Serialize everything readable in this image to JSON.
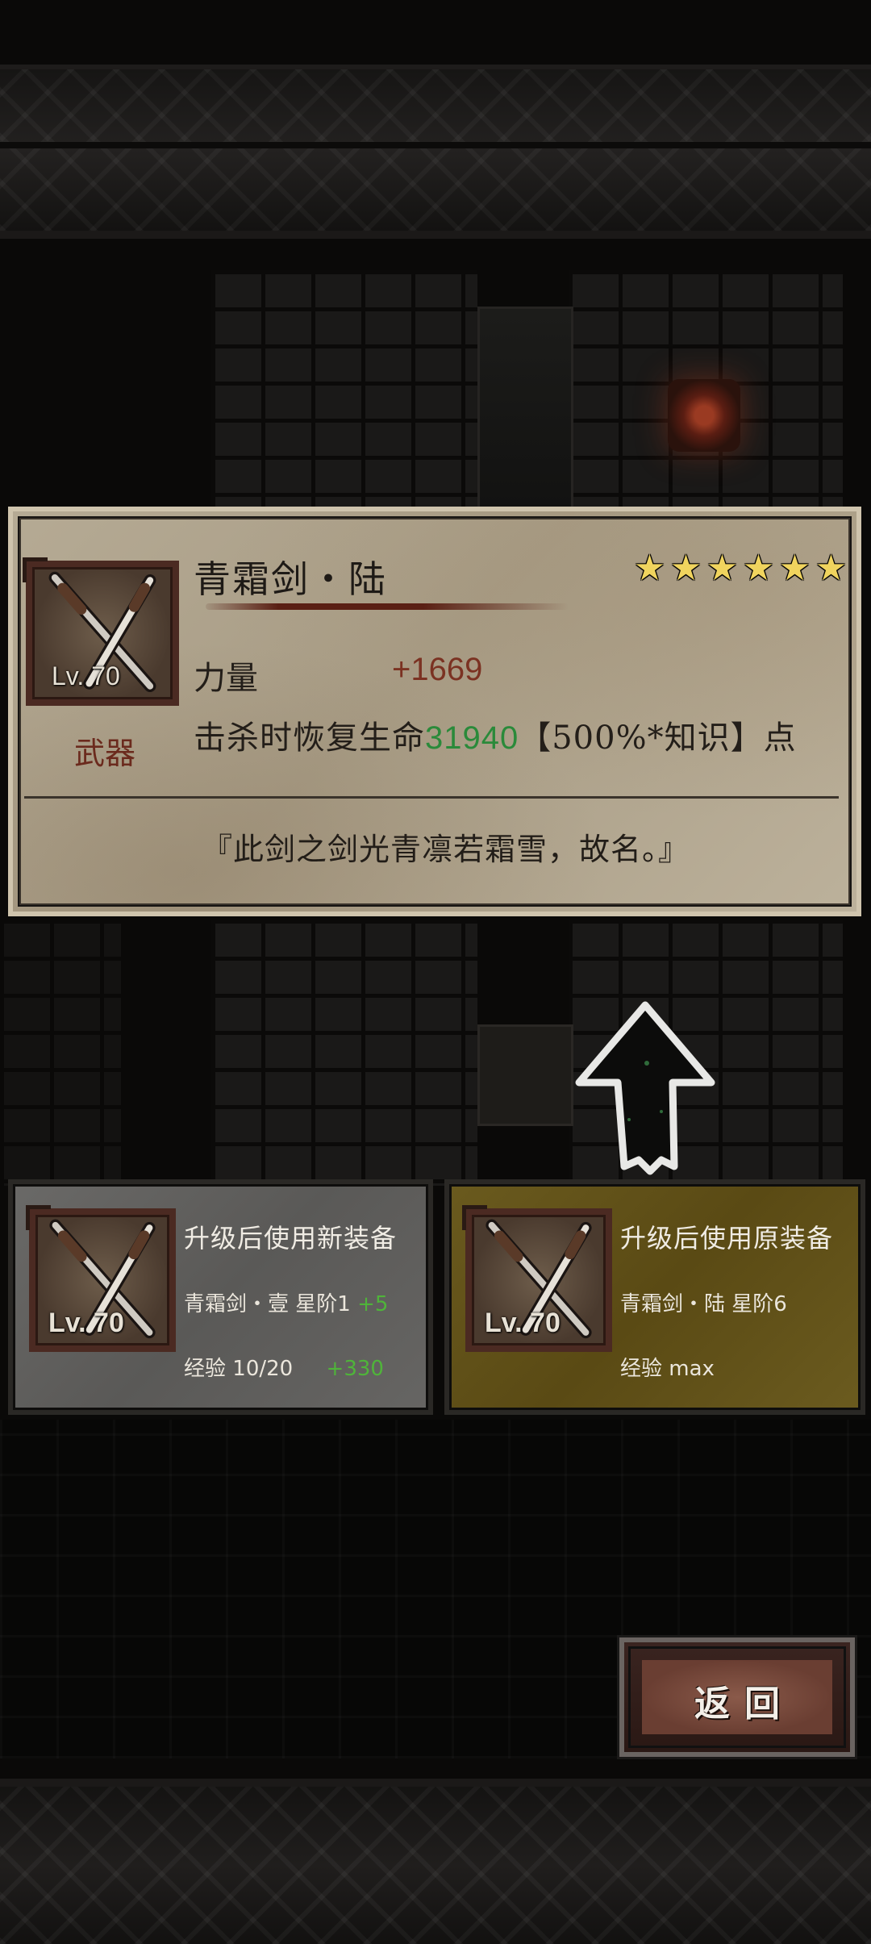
{
  "item": {
    "name": "青霜剑・陆",
    "level": "Lv. 70",
    "category": "武器",
    "stars": [
      "★",
      "★",
      "★",
      "★",
      "★",
      "★"
    ],
    "stats": {
      "strength_label": "力量",
      "strength_value": "+1669",
      "heal_prefix": "击杀时恢复生命",
      "heal_value": "31940",
      "heal_suffix": "【500%*知识】点"
    },
    "flavor_text": "『此剑之剑光青凛若霜雪，故名。』"
  },
  "options": {
    "new": {
      "title": "升级后使用新装备",
      "level": "Lv. 70",
      "item_name": "青霜剑・壹",
      "star_rank": "星阶1",
      "star_bonus": "+5",
      "exp_label": "经验",
      "exp_value": "10/20",
      "exp_bonus": "+330"
    },
    "old": {
      "title": "升级后使用原装备",
      "level": "Lv. 70",
      "item_name": "青霜剑・陆",
      "star_rank": "星阶6",
      "exp_label": "经验",
      "exp_value": "max"
    }
  },
  "back_button": {
    "label": "返回"
  },
  "colors": {
    "parchment": "#b5aa94",
    "accent_green": "#2a8a3a",
    "star_gold": "#f0d45e",
    "new_panel": "#5a5957",
    "old_panel": "#5a4a14"
  },
  "icons": {
    "weapon": "crossed-swords-icon",
    "upgrade": "up-arrow-icon"
  }
}
